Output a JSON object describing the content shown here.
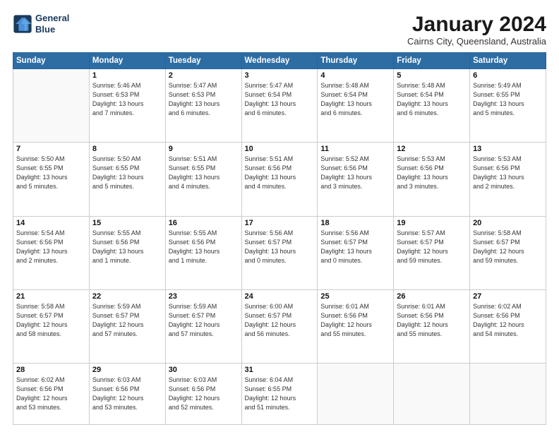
{
  "header": {
    "logo_line1": "General",
    "logo_line2": "Blue",
    "month_title": "January 2024",
    "location": "Cairns City, Queensland, Australia"
  },
  "weekdays": [
    "Sunday",
    "Monday",
    "Tuesday",
    "Wednesday",
    "Thursday",
    "Friday",
    "Saturday"
  ],
  "weeks": [
    [
      {
        "day": "",
        "info": ""
      },
      {
        "day": "1",
        "info": "Sunrise: 5:46 AM\nSunset: 6:53 PM\nDaylight: 13 hours\nand 7 minutes."
      },
      {
        "day": "2",
        "info": "Sunrise: 5:47 AM\nSunset: 6:53 PM\nDaylight: 13 hours\nand 6 minutes."
      },
      {
        "day": "3",
        "info": "Sunrise: 5:47 AM\nSunset: 6:54 PM\nDaylight: 13 hours\nand 6 minutes."
      },
      {
        "day": "4",
        "info": "Sunrise: 5:48 AM\nSunset: 6:54 PM\nDaylight: 13 hours\nand 6 minutes."
      },
      {
        "day": "5",
        "info": "Sunrise: 5:48 AM\nSunset: 6:54 PM\nDaylight: 13 hours\nand 6 minutes."
      },
      {
        "day": "6",
        "info": "Sunrise: 5:49 AM\nSunset: 6:55 PM\nDaylight: 13 hours\nand 5 minutes."
      }
    ],
    [
      {
        "day": "7",
        "info": "Sunrise: 5:50 AM\nSunset: 6:55 PM\nDaylight: 13 hours\nand 5 minutes."
      },
      {
        "day": "8",
        "info": "Sunrise: 5:50 AM\nSunset: 6:55 PM\nDaylight: 13 hours\nand 5 minutes."
      },
      {
        "day": "9",
        "info": "Sunrise: 5:51 AM\nSunset: 6:55 PM\nDaylight: 13 hours\nand 4 minutes."
      },
      {
        "day": "10",
        "info": "Sunrise: 5:51 AM\nSunset: 6:56 PM\nDaylight: 13 hours\nand 4 minutes."
      },
      {
        "day": "11",
        "info": "Sunrise: 5:52 AM\nSunset: 6:56 PM\nDaylight: 13 hours\nand 3 minutes."
      },
      {
        "day": "12",
        "info": "Sunrise: 5:53 AM\nSunset: 6:56 PM\nDaylight: 13 hours\nand 3 minutes."
      },
      {
        "day": "13",
        "info": "Sunrise: 5:53 AM\nSunset: 6:56 PM\nDaylight: 13 hours\nand 2 minutes."
      }
    ],
    [
      {
        "day": "14",
        "info": "Sunrise: 5:54 AM\nSunset: 6:56 PM\nDaylight: 13 hours\nand 2 minutes."
      },
      {
        "day": "15",
        "info": "Sunrise: 5:55 AM\nSunset: 6:56 PM\nDaylight: 13 hours\nand 1 minute."
      },
      {
        "day": "16",
        "info": "Sunrise: 5:55 AM\nSunset: 6:56 PM\nDaylight: 13 hours\nand 1 minute."
      },
      {
        "day": "17",
        "info": "Sunrise: 5:56 AM\nSunset: 6:57 PM\nDaylight: 13 hours\nand 0 minutes."
      },
      {
        "day": "18",
        "info": "Sunrise: 5:56 AM\nSunset: 6:57 PM\nDaylight: 13 hours\nand 0 minutes."
      },
      {
        "day": "19",
        "info": "Sunrise: 5:57 AM\nSunset: 6:57 PM\nDaylight: 12 hours\nand 59 minutes."
      },
      {
        "day": "20",
        "info": "Sunrise: 5:58 AM\nSunset: 6:57 PM\nDaylight: 12 hours\nand 59 minutes."
      }
    ],
    [
      {
        "day": "21",
        "info": "Sunrise: 5:58 AM\nSunset: 6:57 PM\nDaylight: 12 hours\nand 58 minutes."
      },
      {
        "day": "22",
        "info": "Sunrise: 5:59 AM\nSunset: 6:57 PM\nDaylight: 12 hours\nand 57 minutes."
      },
      {
        "day": "23",
        "info": "Sunrise: 5:59 AM\nSunset: 6:57 PM\nDaylight: 12 hours\nand 57 minutes."
      },
      {
        "day": "24",
        "info": "Sunrise: 6:00 AM\nSunset: 6:57 PM\nDaylight: 12 hours\nand 56 minutes."
      },
      {
        "day": "25",
        "info": "Sunrise: 6:01 AM\nSunset: 6:56 PM\nDaylight: 12 hours\nand 55 minutes."
      },
      {
        "day": "26",
        "info": "Sunrise: 6:01 AM\nSunset: 6:56 PM\nDaylight: 12 hours\nand 55 minutes."
      },
      {
        "day": "27",
        "info": "Sunrise: 6:02 AM\nSunset: 6:56 PM\nDaylight: 12 hours\nand 54 minutes."
      }
    ],
    [
      {
        "day": "28",
        "info": "Sunrise: 6:02 AM\nSunset: 6:56 PM\nDaylight: 12 hours\nand 53 minutes."
      },
      {
        "day": "29",
        "info": "Sunrise: 6:03 AM\nSunset: 6:56 PM\nDaylight: 12 hours\nand 53 minutes."
      },
      {
        "day": "30",
        "info": "Sunrise: 6:03 AM\nSunset: 6:56 PM\nDaylight: 12 hours\nand 52 minutes."
      },
      {
        "day": "31",
        "info": "Sunrise: 6:04 AM\nSunset: 6:55 PM\nDaylight: 12 hours\nand 51 minutes."
      },
      {
        "day": "",
        "info": ""
      },
      {
        "day": "",
        "info": ""
      },
      {
        "day": "",
        "info": ""
      }
    ]
  ]
}
